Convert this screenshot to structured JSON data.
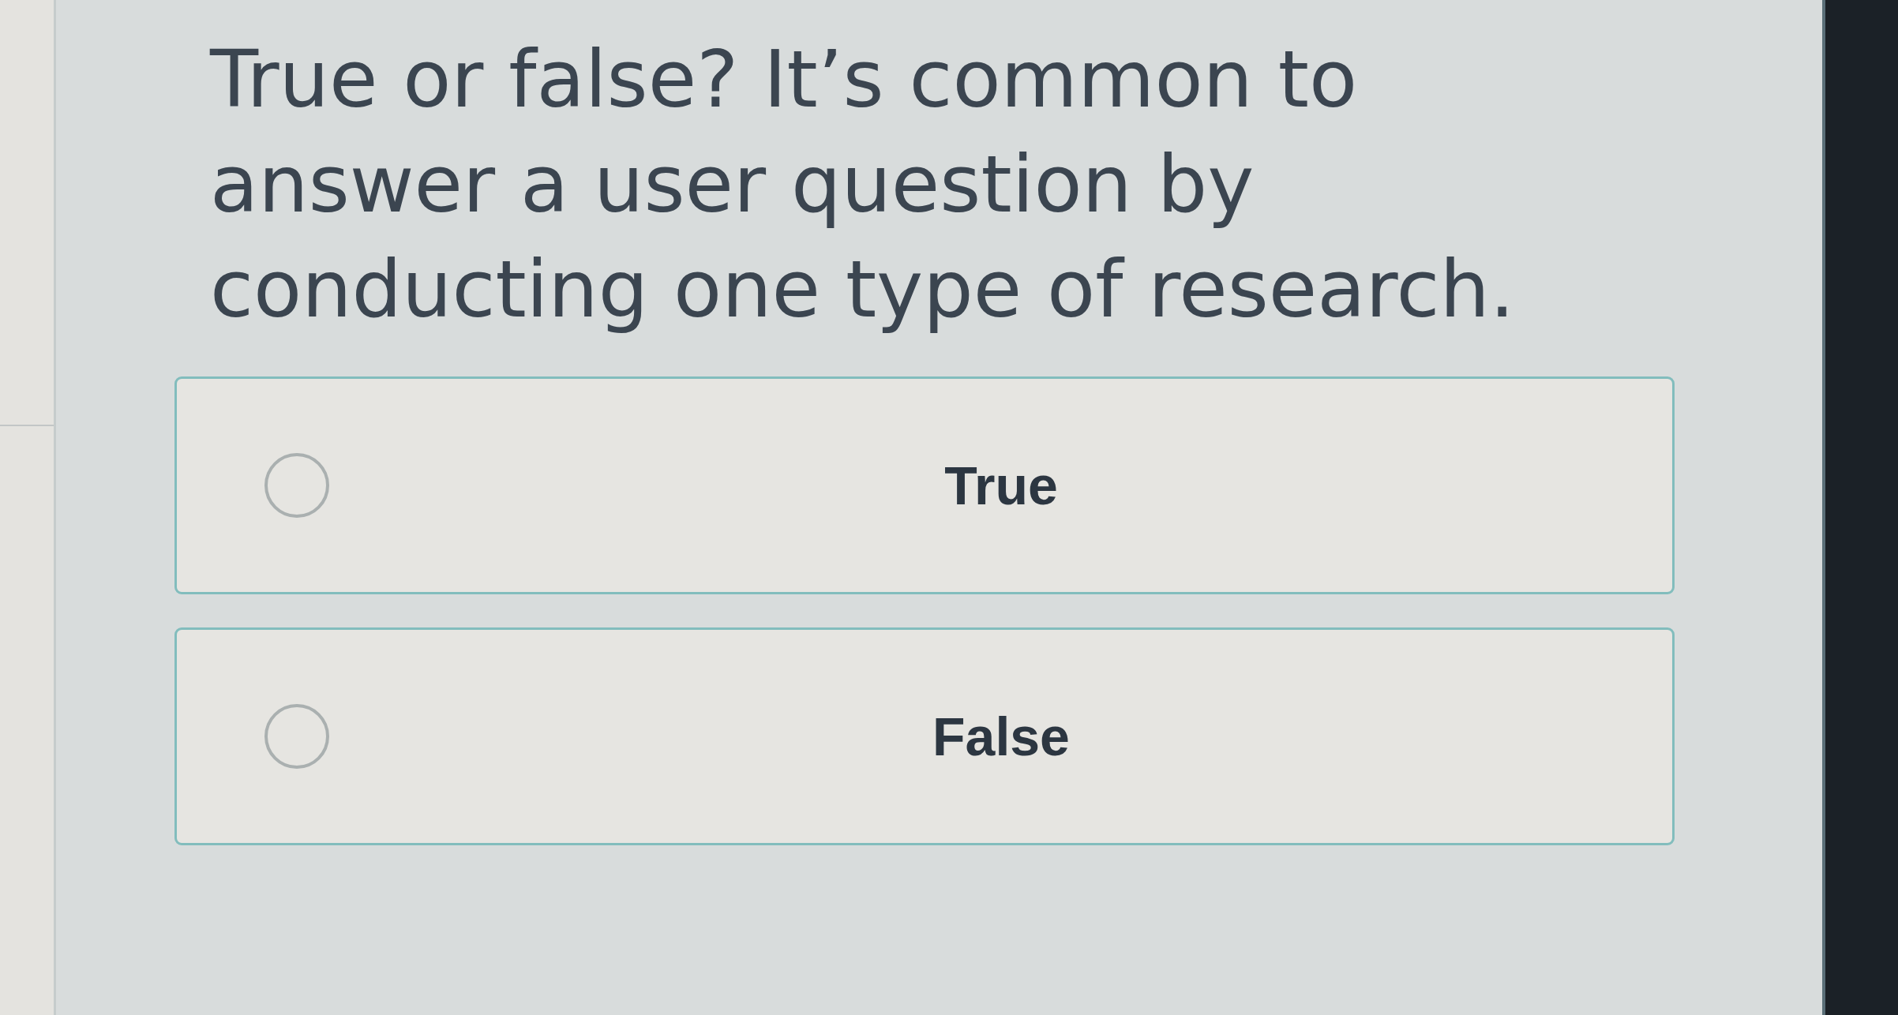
{
  "question": "True or false? It’s common to answer a user question by conducting one type of research.",
  "options": [
    {
      "label": "True",
      "selected": false
    },
    {
      "label": "False",
      "selected": false
    }
  ]
}
